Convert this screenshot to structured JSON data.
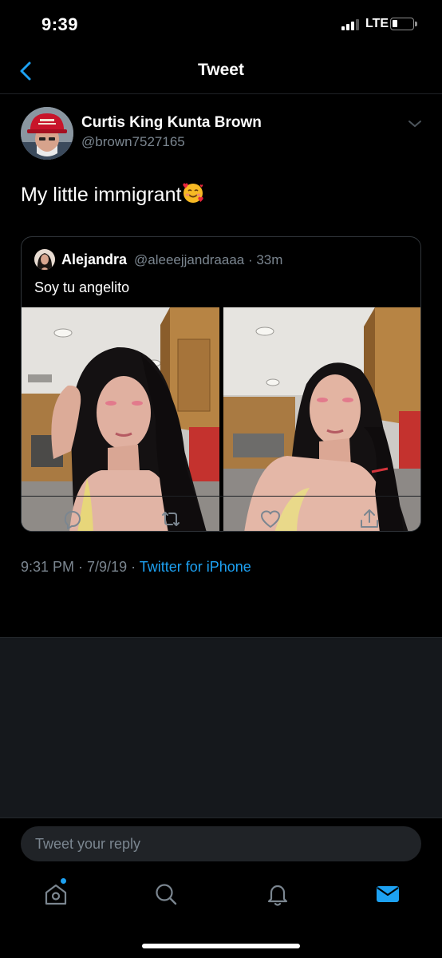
{
  "status_bar": {
    "time": "9:39",
    "network": "LTE",
    "battery_level": 0.2,
    "signal_bars": 3
  },
  "nav": {
    "title": "Tweet",
    "back_icon": "chevron-left-icon"
  },
  "tweet": {
    "author_name": "Curtis King Kunta Brown",
    "author_handle": "@brown7527165",
    "text": "My little immigrant",
    "emoji": "smiling-face-with-hearts",
    "quoted": {
      "name": "Alejandra",
      "handle_time": "@aleeejjandraaaa · 33m",
      "text": "Soy tu angelito"
    },
    "timestamp": "9:31 PM · 7/9/19 · ",
    "source": "Twitter for iPhone"
  },
  "actions": [
    "reply-icon",
    "retweet-icon",
    "like-icon",
    "share-icon"
  ],
  "reply": {
    "placeholder": "Tweet your reply"
  },
  "tabs": [
    "home-icon",
    "search-icon",
    "notifications-icon",
    "messages-icon"
  ],
  "colors": {
    "accent": "#1da1f2",
    "background": "#000000",
    "secondary_text": "#7b8690",
    "feed_background": "#15181c"
  }
}
